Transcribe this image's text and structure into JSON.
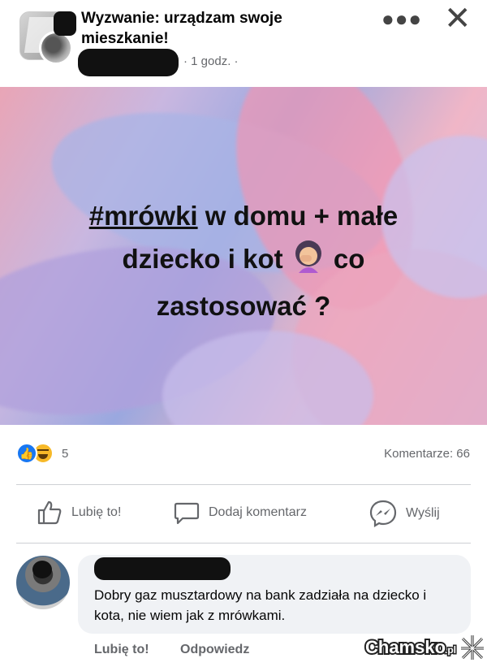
{
  "post": {
    "title": "Wyzwanie: urządzam swoje mieszkanie!",
    "time": "· 1 godz. ·",
    "text_hashtag": "#mrówki",
    "text_line1_rest": " w domu + małe",
    "text_line2_a": "dziecko i kot ",
    "text_line2_b": " co",
    "text_line3": "zastosować ?",
    "emoji": "woman-facepalming-emoji"
  },
  "stats": {
    "reaction_count": "5",
    "comments": "Komentarze: 66",
    "reaction_icons": [
      "like-icon",
      "haha-icon"
    ]
  },
  "actions": {
    "like": "Lubię to!",
    "comment": "Dodaj komentarz",
    "send": "Wyślij"
  },
  "comment": {
    "text": "Dobry gaz musztardowy na bank zadziała na dziecko i kota, nie wiem jak z mrówkami.",
    "like": "Lubię to!",
    "reply": "Odpowiedz"
  },
  "watermark": {
    "brand": "Chamsko",
    "suffix": ".pl"
  },
  "colors": {
    "facebook_blue": "#1877f2",
    "meta_gray": "#65676b",
    "bubble": "#f0f2f5"
  }
}
